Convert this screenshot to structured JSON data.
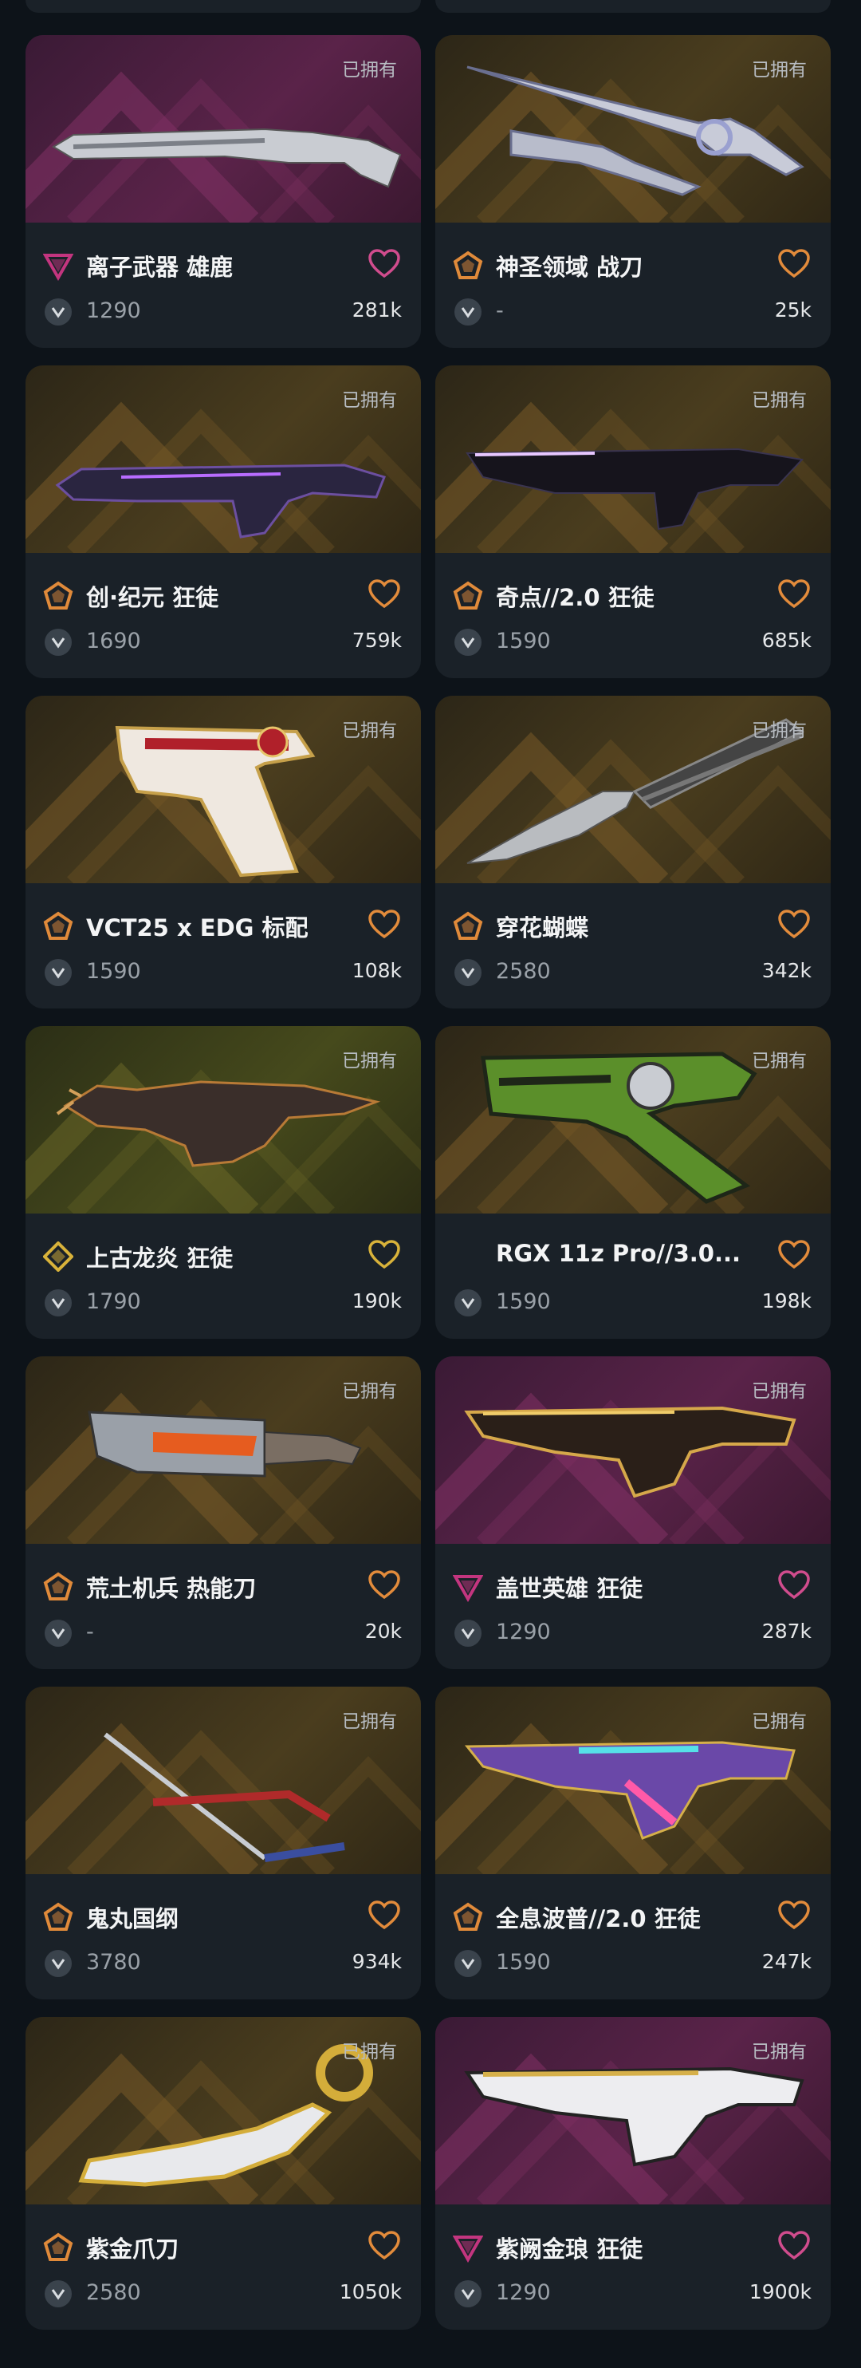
{
  "owned_label": "已拥有",
  "colors": {
    "tier_purple": "#c3357f",
    "tier_orange": "#e08a3a",
    "tier_gold": "#d8b23a",
    "heart_pink": "#d04c8d",
    "heart_orange": "#e28b3b",
    "heart_gold": "#d8b23a"
  },
  "cards": [
    {
      "name": "离子武器 雄鹿",
      "price": "1290",
      "likes": "281k",
      "tier": "purple",
      "bg": "purple",
      "weapon": "shotgun-silver"
    },
    {
      "name": "神圣领域 战刀",
      "price": "-",
      "likes": "25k",
      "tier": "orange",
      "bg": "gold",
      "weapon": "blade-silver"
    },
    {
      "name": "创·纪元 狂徒",
      "price": "1690",
      "likes": "759k",
      "tier": "orange",
      "bg": "gold",
      "weapon": "rifle-dark"
    },
    {
      "name": "奇点//2.0 狂徒",
      "price": "1590",
      "likes": "685k",
      "tier": "orange",
      "bg": "gold",
      "weapon": "rifle-black"
    },
    {
      "name": "VCT25 x EDG 标配",
      "price": "1590",
      "likes": "108k",
      "tier": "orange",
      "bg": "gold",
      "weapon": "pistol-edg"
    },
    {
      "name": "穿花蝴蝶",
      "price": "2580",
      "likes": "342k",
      "tier": "orange",
      "bg": "gold",
      "weapon": "butterfly-knife"
    },
    {
      "name": "上古龙炎 狂徒",
      "price": "1790",
      "likes": "190k",
      "tier": "gold",
      "bg": "olive",
      "weapon": "dragon-rifle"
    },
    {
      "name": "RGX 11z Pro//3.0...",
      "price": "1590",
      "likes": "198k",
      "tier": "none",
      "bg": "gold",
      "weapon": "revolver-green"
    },
    {
      "name": "荒土机兵 热能刀",
      "price": "-",
      "likes": "20k",
      "tier": "orange",
      "bg": "gold",
      "weapon": "heat-knife"
    },
    {
      "name": "盖世英雄 狂徒",
      "price": "1290",
      "likes": "287k",
      "tier": "purple",
      "bg": "purple",
      "weapon": "rifle-gold"
    },
    {
      "name": "鬼丸国纲",
      "price": "3780",
      "likes": "934k",
      "tier": "orange",
      "bg": "gold",
      "weapon": "katana"
    },
    {
      "name": "全息波普//2.0 狂徒",
      "price": "1590",
      "likes": "247k",
      "tier": "orange",
      "bg": "gold",
      "weapon": "rifle-holo"
    },
    {
      "name": "紫金爪刀",
      "price": "2580",
      "likes": "1050k",
      "tier": "orange",
      "bg": "gold",
      "weapon": "karambit"
    },
    {
      "name": "紫阙金琅 狂徒",
      "price": "1290",
      "likes": "1900k",
      "tier": "purple",
      "bg": "purple",
      "weapon": "rifle-white"
    }
  ]
}
